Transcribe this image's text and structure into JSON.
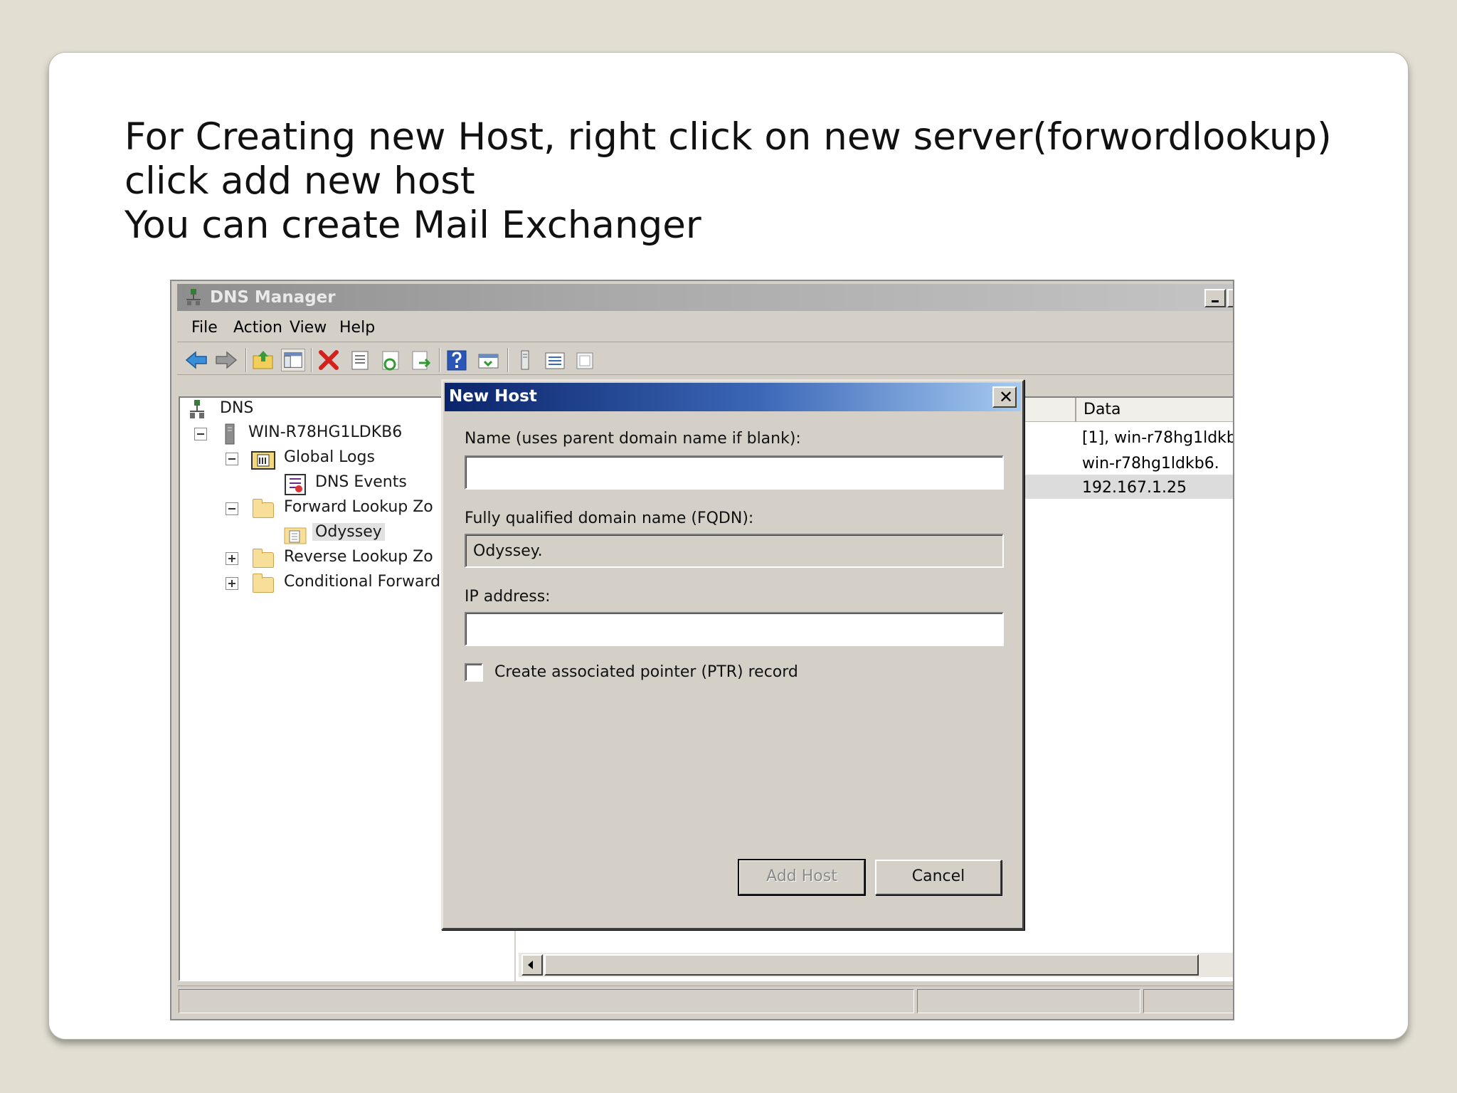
{
  "slide": {
    "lines": [
      "For Creating new Host, right click on new server(forwordlookup)",
      "click add new host",
      "You can create Mail Exchanger"
    ]
  },
  "window": {
    "title": "DNS Manager",
    "menu": [
      "File",
      "Action",
      "View",
      "Help"
    ]
  },
  "tree": {
    "root": "DNS",
    "server": "WIN-R78HG1LDKB6",
    "global_logs": "Global Logs",
    "dns_events": "DNS Events",
    "forward_lookup": "Forward Lookup Zo",
    "odyssey": "Odyssey",
    "reverse_lookup": "Reverse Lookup Zo",
    "conditional": "Conditional Forward"
  },
  "list": {
    "column_data": "Data",
    "rows": [
      "[1], win-r78hg1ldkb",
      "win-r78hg1ldkb6.",
      "192.167.1.25"
    ]
  },
  "dialog": {
    "title": "New Host",
    "name_label": "Name (uses parent domain name if blank):",
    "name_value": "",
    "fqdn_label": "Fully qualified domain name (FQDN):",
    "fqdn_value": "Odyssey.",
    "ip_label": "IP address:",
    "ip_value": "",
    "ptr_label": "Create associated pointer (PTR) record",
    "ptr_checked": false,
    "add_host_label": "Add Host",
    "cancel_label": "Cancel"
  },
  "colors": {
    "dialog_title_start": "#0a246a",
    "dialog_title_end": "#a6caf0",
    "window_face": "#d4d0c8",
    "slide_background": "#e2dfd2"
  }
}
